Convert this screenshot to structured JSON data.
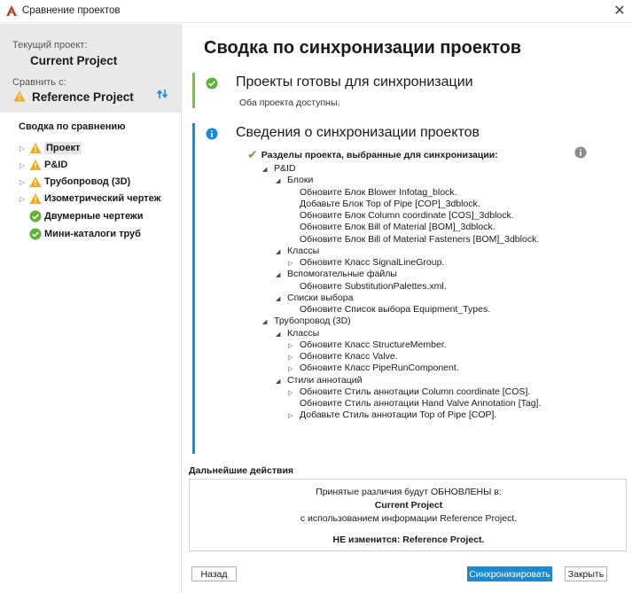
{
  "window": {
    "title": "Сравнение проектов",
    "close_glyph": "✕"
  },
  "left": {
    "current_label": "Текущий проект:",
    "current_name": "Current Project",
    "compare_label": "Сравнить с:",
    "compare_name": "Reference Project",
    "tree_title": "Сводка по сравнению",
    "tree_items": [
      {
        "label": "Проект",
        "status": "warning",
        "expandable": true,
        "selected": true
      },
      {
        "label": "P&ID",
        "status": "warning",
        "expandable": true
      },
      {
        "label": "Трубопровод (3D)",
        "status": "warning",
        "expandable": true
      },
      {
        "label": "Изометрический чертеж",
        "status": "warning",
        "expandable": true
      },
      {
        "label": "Двумерные чертежи",
        "status": "ok",
        "expandable": false
      },
      {
        "label": "Мини-каталоги труб",
        "status": "ok",
        "expandable": false
      }
    ]
  },
  "main": {
    "title": "Сводка по синхронизации проектов",
    "ready": {
      "heading": "Проекты готовы для синхронизации",
      "sub": "Оба проекта доступны."
    },
    "info": {
      "heading": "Сведения о синхронизации проектов",
      "selected_label": "Разделы проекта, выбранные для синхронизации:"
    },
    "tree": [
      {
        "text": "P&ID",
        "marker": "open",
        "level": 0
      },
      {
        "text": "Блоки",
        "marker": "open",
        "level": 1
      },
      {
        "text": "Обновите Блок Blower Infotag_block.",
        "marker": "none",
        "level": 2
      },
      {
        "text": "Добавьте Блок Top of Pipe [COP]_3dblock.",
        "marker": "none",
        "level": 2
      },
      {
        "text": "Обновите Блок Column coordinate [COS]_3dblock.",
        "marker": "none",
        "level": 2
      },
      {
        "text": "Обновите Блок Bill of Material [BOM]_3dblock.",
        "marker": "none",
        "level": 2
      },
      {
        "text": "Обновите Блок Bill of Material Fasteners [BOM]_3dblock.",
        "marker": "none",
        "level": 2
      },
      {
        "text": "Классы",
        "marker": "open",
        "level": 1
      },
      {
        "text": "Обновите Класс SignalLineGroup.",
        "marker": "closed",
        "level": 2
      },
      {
        "text": "Вспомогательные файлы",
        "marker": "open",
        "level": 1
      },
      {
        "text": "Обновите  SubstitutionPalettes.xml.",
        "marker": "none",
        "level": 2
      },
      {
        "text": "Списки выбора",
        "marker": "open",
        "level": 1
      },
      {
        "text": "Обновите Список выбора Equipment_Types.",
        "marker": "none",
        "level": 2
      },
      {
        "text": "Трубопровод (3D)",
        "marker": "open",
        "level": 0
      },
      {
        "text": "Классы",
        "marker": "open",
        "level": 1
      },
      {
        "text": "Обновите Класс StructureMember.",
        "marker": "closed",
        "level": 2
      },
      {
        "text": "Обновите Класс Valve.",
        "marker": "closed",
        "level": 2
      },
      {
        "text": "Обновите Класс PipeRunComponent.",
        "marker": "closed",
        "level": 2
      },
      {
        "text": "Стили аннотаций",
        "marker": "open",
        "level": 1
      },
      {
        "text": "Обновите Стиль аннотации Column coordinate [COS].",
        "marker": "closed",
        "level": 2
      },
      {
        "text": "Обновите Стиль аннотации Hand Valve Annotation [Tag].",
        "marker": "none",
        "level": 2
      },
      {
        "text": "Добавьте Стиль аннотации Top of Pipe [COP].",
        "marker": "closed",
        "level": 2
      }
    ],
    "further": {
      "title": "Дальнейшие действия",
      "line1": "Принятые различия будут ОБНОВЛЕНЫ в:",
      "line2": "Current Project",
      "line3": "с использованием информации Reference Project.",
      "line4": "НЕ изменится: Reference Project."
    }
  },
  "buttons": {
    "back": "Назад",
    "sync": "Синхронизировать",
    "close": "Закрыть"
  },
  "colors": {
    "warning": "#f5a623",
    "ok": "#5cb23a",
    "info": "#1a8ad6",
    "accent_bar_ready": "#7cc242",
    "accent_bar_info": "#1a8ad6",
    "primary_button": "#1a8ad6",
    "sidebar_header": "#e9e9e9"
  },
  "icons": {
    "app": "autocad-logo-icon",
    "warning": "warning-triangle-icon",
    "ok": "check-circle-icon",
    "info": "info-circle-icon",
    "swap": "swap-arrows-icon"
  }
}
